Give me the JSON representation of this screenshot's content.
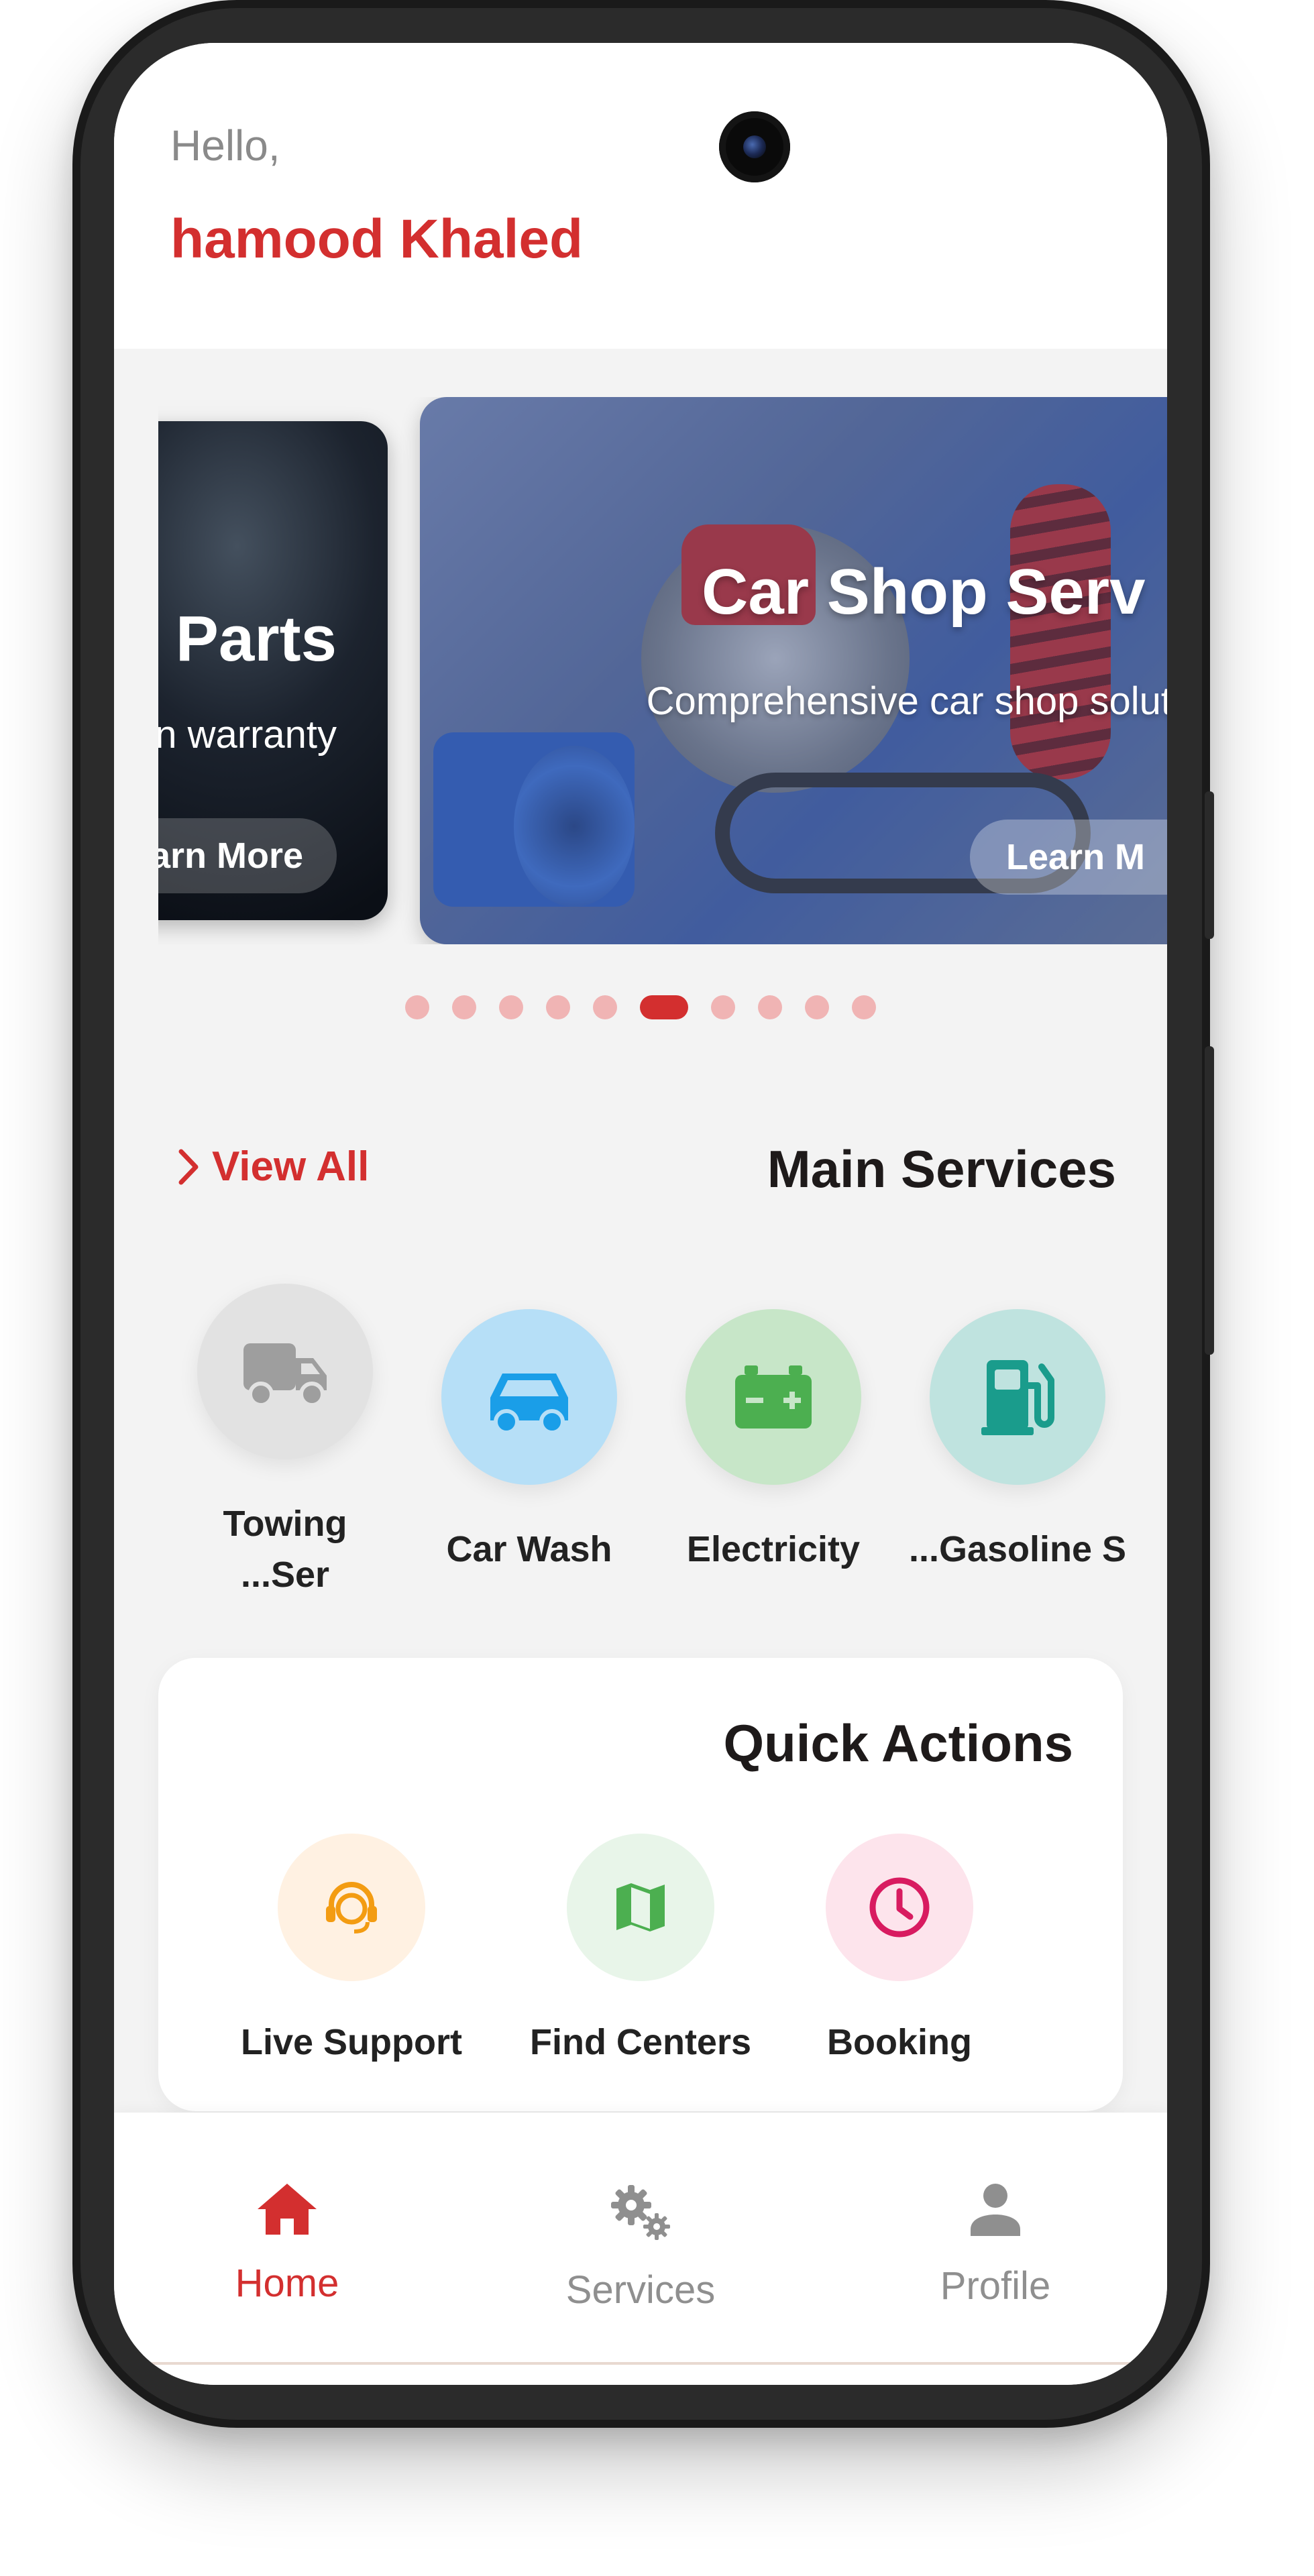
{
  "header": {
    "greeting": "Hello,",
    "user_name": "hamood Khaled"
  },
  "carousel": {
    "slides": [
      {
        "title": "e Parts",
        "subtitle": "n warranty",
        "button_label": "arn More"
      },
      {
        "title": "Car Shop Serv",
        "subtitle": "Comprehensive car shop solution your ne",
        "button_label": "Learn M"
      }
    ],
    "page_count": 10,
    "active_index": 5
  },
  "main_services": {
    "title": "Main Services",
    "view_all_label": "View All",
    "items": [
      {
        "label": "Towing ...Ser",
        "line1": "Towing",
        "line2": "...Ser",
        "icon": "truck-icon",
        "bg": "#e2e2e2",
        "fg": "#9e9e9e"
      },
      {
        "label": "Car Wash",
        "icon": "car-icon",
        "bg": "#b6dff7",
        "fg": "#1a9ee8"
      },
      {
        "label": "Electricity",
        "icon": "battery-icon",
        "bg": "#c7e6c8",
        "fg": "#4caf50"
      },
      {
        "label": "...Gasoline S",
        "icon": "fuel-pump-icon",
        "bg": "#bfe3df",
        "fg": "#1a9c8c"
      }
    ]
  },
  "quick_actions": {
    "title": "Quick Actions",
    "items": [
      {
        "label": "Live Support",
        "icon": "support-agent-icon",
        "bg": "#fff1e2",
        "fg": "#f39c12"
      },
      {
        "label": "Find Centers",
        "icon": "map-icon",
        "bg": "#e8f5e9",
        "fg": "#4caf50"
      },
      {
        "label": "Booking",
        "icon": "clock-icon",
        "bg": "#fde4ec",
        "fg": "#d81b60"
      }
    ]
  },
  "bottom_nav": {
    "items": [
      {
        "label": "Home",
        "icon": "home-icon",
        "active": true
      },
      {
        "label": "Services",
        "icon": "gears-icon",
        "active": false
      },
      {
        "label": "Profile",
        "icon": "person-icon",
        "active": false
      }
    ]
  },
  "colors": {
    "accent": "#d32f2f",
    "inactive": "#8f8f8f",
    "background": "#f3f3f3"
  }
}
